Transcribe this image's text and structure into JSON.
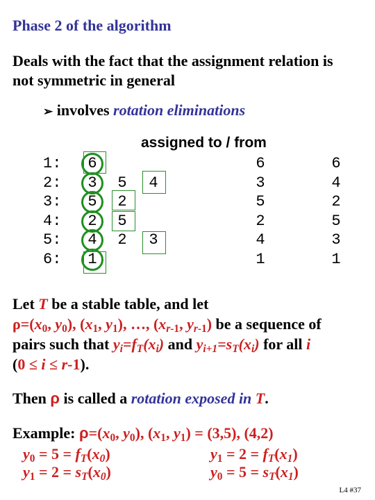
{
  "title": "Phase 2 of the algorithm",
  "intro": {
    "line1": "Deals with the fact that the assignment relation is",
    "line2": "not symmetric in general"
  },
  "bullet": {
    "icon": "arrow-bullet-icon",
    "glyph": "➢",
    "prefix": "involves",
    "emphasis": "rotation eliminations"
  },
  "table": {
    "header": "assigned to / from",
    "row_labels": [
      "1:",
      "2:",
      "3:",
      "4:",
      "5:",
      "6:"
    ],
    "col1": [
      "6",
      "3",
      "5",
      "2",
      "4",
      "1"
    ],
    "col2": [
      "",
      "5",
      "2",
      "5",
      "2",
      ""
    ],
    "col3": [
      "",
      "4",
      "",
      "",
      "3",
      ""
    ],
    "assigned_to": [
      "6",
      "3",
      "5",
      "2",
      "4",
      "1"
    ],
    "assigned_from": [
      "6",
      "4",
      "2",
      "5",
      "3",
      "1"
    ],
    "highlight_color": "#1f8f1f"
  },
  "definition": {
    "let": "Let",
    "T": "T",
    "rest1": " be a stable table, and let",
    "rho_seq": "ρ=(x",
    "be_seq": " be a sequence of",
    "pairs": "pairs such that",
    "and": " and ",
    "for_all": " for all ",
    "i": "i",
    "range_open": "(",
    "range": "0 ≤ i ≤ r-1",
    "range_close": ")."
  },
  "then": {
    "prefix": "Then",
    "rho": "ρ",
    "middle": "is called a",
    "emphasis": "rotation exposed in",
    "T": "T",
    "end": "."
  },
  "example": {
    "label": "Example:",
    "values": "= (3,5), (4,2)",
    "eq1_left": "= 5 = ",
    "eq1_right": "= 2 = ",
    "eq2_left": "= 2 = ",
    "eq2_right": "= 5 = "
  },
  "footer": "L4 #37",
  "colors": {
    "blue": "#333399",
    "red": "#cc1f1f",
    "green": "#1f8f1f"
  }
}
